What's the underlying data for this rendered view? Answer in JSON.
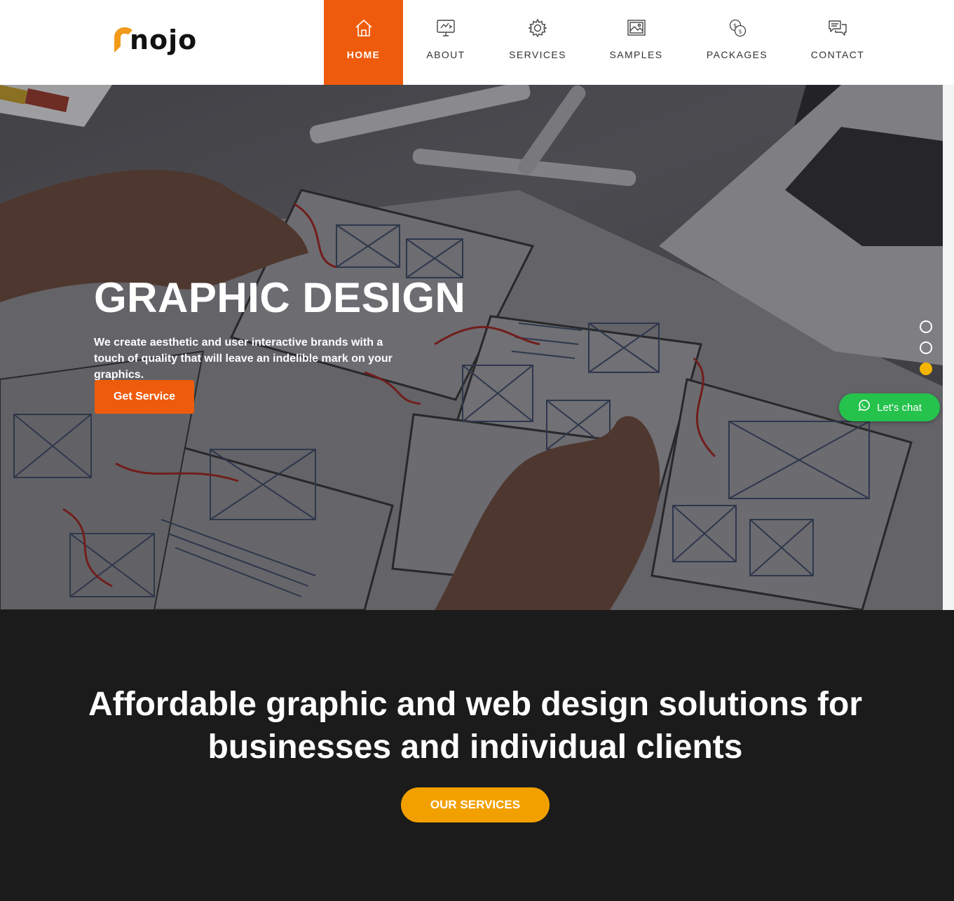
{
  "brand": {
    "name": "nojo",
    "accent": "#ef5b0c",
    "secondary": "#f2a000"
  },
  "nav": {
    "items": [
      {
        "label": "HOME",
        "icon": "home-icon",
        "active": true
      },
      {
        "label": "ABOUT",
        "icon": "monitor-icon",
        "active": false
      },
      {
        "label": "SERVICES",
        "icon": "gear-icon",
        "active": false
      },
      {
        "label": "SAMPLES",
        "icon": "image-icon",
        "active": false
      },
      {
        "label": "PACKAGES",
        "icon": "coins-icon",
        "active": false
      },
      {
        "label": "CONTACT",
        "icon": "chat-icon",
        "active": false
      }
    ]
  },
  "hero": {
    "title": "GRAPHIC DESIGN",
    "subtitle": "We create aesthetic and user interactive brands with a touch of quality that will leave an indelible mark on your graphics.",
    "cta_label": "Get Service",
    "slides": {
      "count": 3,
      "active": 3
    }
  },
  "chat": {
    "label": "Let's chat",
    "color": "#25c24c"
  },
  "section": {
    "heading_line1": "Affordable graphic and web design solutions for",
    "heading_line2": "businesses and individual clients",
    "cta_label": "OUR SERVICES"
  }
}
